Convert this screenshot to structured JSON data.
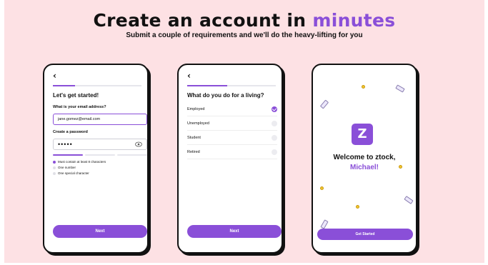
{
  "header": {
    "title_main": "Create an account in",
    "title_accent": "minutes",
    "subtitle": "Submit a couple of requirements and we'll do the heavy-lifting for you"
  },
  "colors": {
    "background": "#fde1e4",
    "accent": "#8a4fd8",
    "text": "#111111"
  },
  "phone1": {
    "back_icon": "chevron-left-icon",
    "progress": 0.25,
    "title": "Let's get started!",
    "email_label": "What is your email address?",
    "email_value": "jane.gomez@email.com",
    "password_label": "Create a password",
    "password_value": "•••••",
    "eye_icon": "eye-icon",
    "rules": [
      "Must contain at least 8 characters",
      "One number",
      "One special character"
    ],
    "next_label": "Next"
  },
  "phone2": {
    "back_icon": "chevron-left-icon",
    "progress": 0.45,
    "title": "What do you do for a living?",
    "options": [
      "Employed",
      "Unemployed",
      "Student",
      "Retired"
    ],
    "selected": "Employed",
    "next_label": "Next"
  },
  "phone3": {
    "logo_letter": "Z",
    "welcome": "Welcome to ztock,",
    "name": "Michael!",
    "start_label": "Get Started"
  }
}
